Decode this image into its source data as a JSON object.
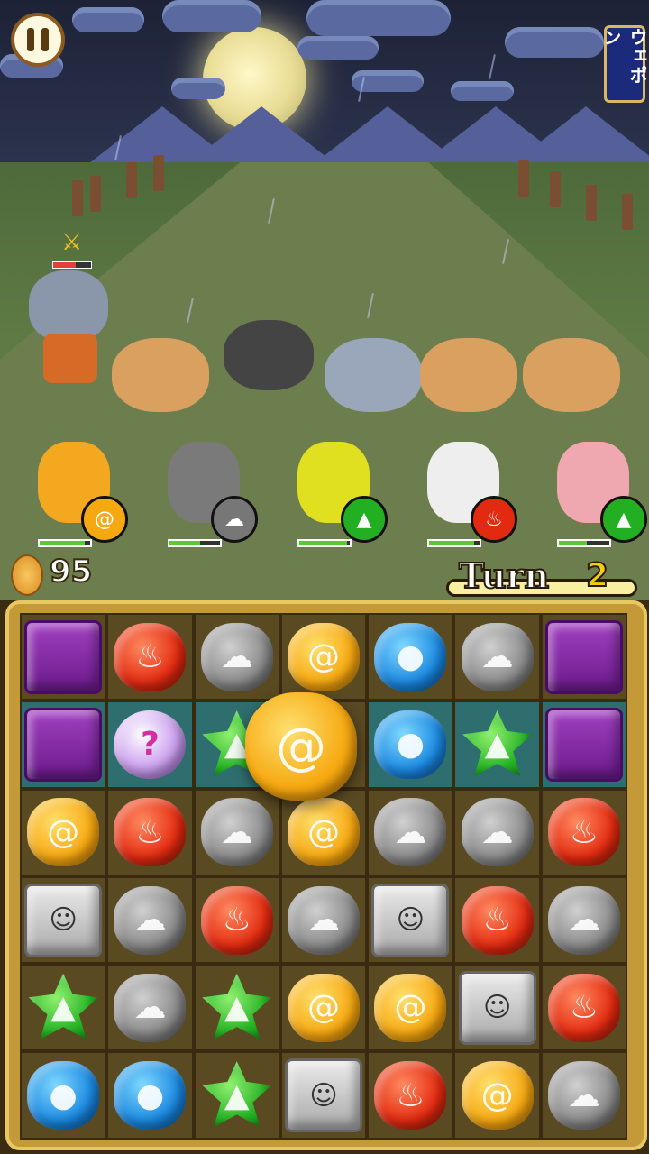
{
  "hud": {
    "pause_icon": "pause-icon",
    "weapon_label": "ウェポン",
    "coins": "95",
    "turn_label": "Turn",
    "turn_number": "2"
  },
  "enemy": {
    "name_icon": "sword-icon",
    "hp_fraction": 0.6
  },
  "party": [
    {
      "element": "wind",
      "badge_icon": "tornado-icon",
      "color": "#f6a810",
      "hp_fraction": 0.9
    },
    {
      "element": "dark",
      "badge_icon": "cloud-icon",
      "color": "#777777",
      "hp_fraction": 0.6
    },
    {
      "element": "earth",
      "badge_icon": "mountain-icon",
      "color": "#22b022",
      "hp_fraction": 0.95
    },
    {
      "element": "fire",
      "badge_icon": "flame-icon",
      "color": "#e22a10",
      "hp_fraction": 0.9
    },
    {
      "element": "earth",
      "badge_icon": "mountain-icon",
      "color": "#22b022",
      "hp_fraction": 0.55
    }
  ],
  "board": {
    "highlight_row": 1,
    "rows": [
      [
        "block",
        "fire",
        "dark",
        "wind",
        "water",
        "dark",
        "block"
      ],
      [
        "block",
        "mystery",
        "earth",
        "wind",
        "water",
        "earth",
        "block"
      ],
      [
        "wind",
        "fire",
        "dark",
        "wind",
        "dark",
        "dark",
        "fire"
      ],
      [
        "stone",
        "dark",
        "fire",
        "dark",
        "stone",
        "fire",
        "dark"
      ],
      [
        "earth",
        "dark",
        "earth",
        "wind",
        "wind",
        "stone",
        "fire"
      ],
      [
        "water",
        "water",
        "earth",
        "stone",
        "fire",
        "wind",
        "dark"
      ]
    ],
    "held_tile": "wind"
  },
  "tile_glyphs": {
    "fire": "♨",
    "wind": "@",
    "water": "●",
    "dark": "☁",
    "earth": "▲",
    "block": "",
    "stone": "☺",
    "mystery": "?"
  }
}
